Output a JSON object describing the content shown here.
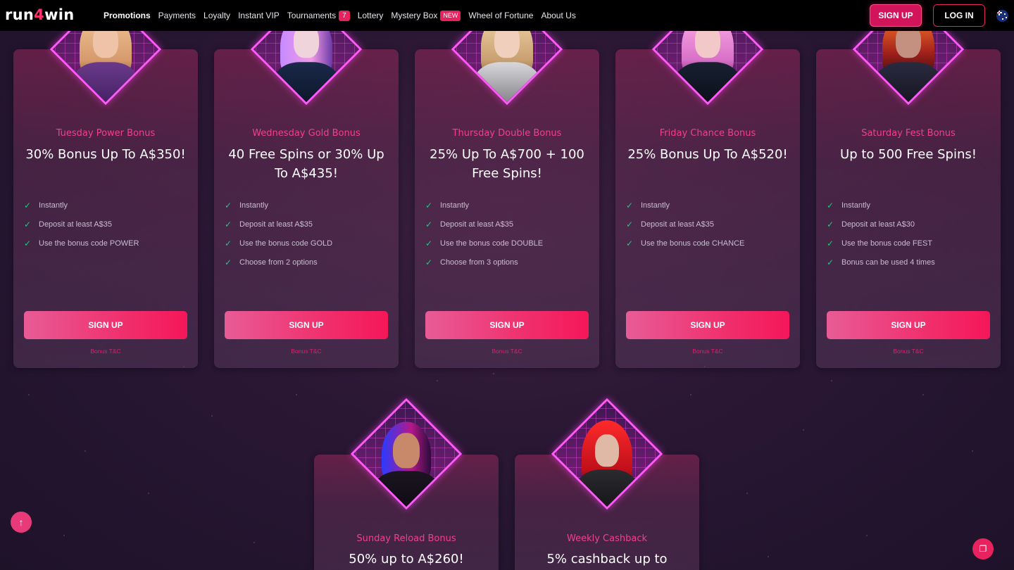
{
  "header": {
    "logo_prefix": "run",
    "logo_four": "4",
    "logo_suffix": "win",
    "nav": [
      {
        "label": "Promotions",
        "active": true
      },
      {
        "label": "Payments"
      },
      {
        "label": "Loyalty"
      },
      {
        "label": "Instant VIP"
      },
      {
        "label": "Tournaments",
        "badge": "7"
      },
      {
        "label": "Lottery"
      },
      {
        "label": "Mystery Box",
        "badge_new": "NEW"
      },
      {
        "label": "Wheel of Fortune"
      },
      {
        "label": "About Us"
      }
    ],
    "signup_label": "SIGN UP",
    "login_label": "LOG IN",
    "flag_icon": "australia-flag-icon"
  },
  "cards": [
    {
      "subtitle": "Tuesday Power Bonus",
      "title": "30% Bonus Up To A$350!",
      "features": [
        "Instantly",
        "Deposit at least A$35",
        "Use the bonus code POWER"
      ],
      "button": "SIGN UP",
      "tnc": "Bonus T&C"
    },
    {
      "subtitle": "Wednesday Gold Bonus",
      "title": "40 Free Spins or 30% Up To A$435!",
      "features": [
        "Instantly",
        "Deposit at least A$35",
        "Use the bonus code GOLD",
        "Choose from 2 options"
      ],
      "button": "SIGN UP",
      "tnc": "Bonus T&C"
    },
    {
      "subtitle": "Thursday Double Bonus",
      "title": "25% Up To A$700 + 100 Free Spins!",
      "features": [
        "Instantly",
        "Deposit at least A$35",
        "Use the bonus code DOUBLE",
        "Choose from 3 options"
      ],
      "button": "SIGN UP",
      "tnc": "Bonus T&C"
    },
    {
      "subtitle": "Friday Chance Bonus",
      "title": "25% Bonus Up To A$520!",
      "features": [
        "Instantly",
        "Deposit at least A$35",
        "Use the bonus code CHANCE"
      ],
      "button": "SIGN UP",
      "tnc": "Bonus T&C"
    },
    {
      "subtitle": "Saturday Fest Bonus",
      "title": "Up to 500 Free Spins!",
      "features": [
        "Instantly",
        "Deposit at least A$30",
        "Use the bonus code FEST",
        "Bonus can be used 4 times"
      ],
      "button": "SIGN UP",
      "tnc": "Bonus T&C"
    }
  ],
  "bottom_cards": [
    {
      "subtitle": "Sunday Reload Bonus",
      "title": "50% up to A$260!"
    },
    {
      "subtitle": "Weekly Cashback",
      "title": "5% cashback up to"
    }
  ],
  "floating": {
    "scroll_top_icon": "arrow-up-icon",
    "chat_icon": "chat-icon"
  },
  "colors": {
    "accent": "#e8225e",
    "subtitle": "#f0418a",
    "check": "#22c77a",
    "header_bg": "#000000"
  }
}
